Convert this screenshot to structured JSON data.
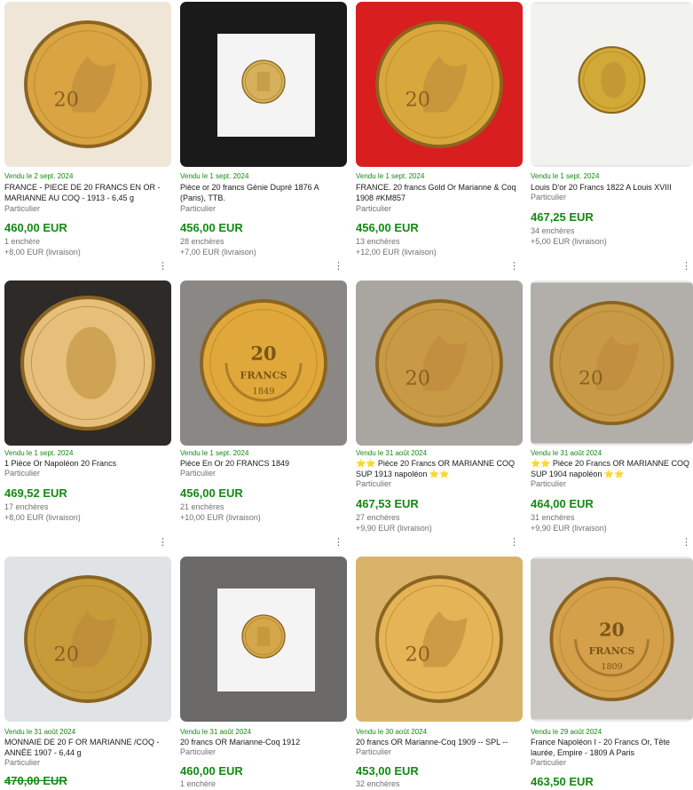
{
  "results": [
    {
      "sold": "Vendu le 2 sept. 2024",
      "title": "FRANCE - PIECE DE 20 FRANCS EN OR - MARIANNE AU COQ - 1913 - 6,45 g",
      "seller": "Particulier",
      "price": "460,00 EUR",
      "bids": "1 enchère",
      "shipping": "+8,00 EUR (livraison)",
      "coin": "rooster",
      "bg": "#efe6d8",
      "coinColor": "#d9a441"
    },
    {
      "sold": "Vendu le 1 sept. 2024",
      "title": "Pièce or 20 francs Génie Dupré 1876 A (Paris), TTB.",
      "seller": "Particulier",
      "price": "456,00 EUR",
      "bids": "28 enchères",
      "shipping": "+7,00 EUR (livraison)",
      "coin": "holder",
      "bg": "#1a1a1a",
      "coinColor": "#d4b15a"
    },
    {
      "sold": "Vendu le 1 sept. 2024",
      "title": "FRANCE. 20 francs Gold Or Marianne & Coq 1908 #KM857",
      "seller": "Particulier",
      "price": "456,00 EUR",
      "bids": "13 enchères",
      "shipping": "+12,00 EUR (livraison)",
      "coin": "rooster",
      "bg": "#d81e1e",
      "coinColor": "#d9a83c"
    },
    {
      "sold": "Vendu le 1 sept. 2024",
      "title": "Louis D'or 20 Francs 1822 A Louis XVIII",
      "seller": "Particulier",
      "price": "467,25 EUR",
      "bids": "34 enchères",
      "shipping": "+5,00 EUR (livraison)",
      "coin": "head",
      "bg": "#f2f2ef",
      "coinColor": "#d1a936"
    },
    {
      "sold": "Vendu le 1 sept. 2024",
      "title": "1 Pièce Or Napoléon 20 Francs",
      "seller": "Particulier",
      "price": "469,52 EUR",
      "bids": "17 enchères",
      "shipping": "+8,00 EUR (livraison)",
      "coin": "marianne",
      "bg": "#2e2a28",
      "coinColor": "#e6c07a"
    },
    {
      "sold": "Vendu le 1 sept. 2024",
      "title": "Pièce En Or 20 FRANCS 1849",
      "seller": "Particulier",
      "price": "456,00 EUR",
      "bids": "21 enchères",
      "shipping": "+10,00 EUR (livraison)",
      "coin": "wreath",
      "bg": "#8a8784",
      "coinColor": "#e0a83a"
    },
    {
      "sold": "Vendu le 31 août 2024",
      "title": "Pièce 20 Francs OR MARIANNE COQ SUP 1913 napoléon",
      "seller": "Particulier",
      "price": "467,53 EUR",
      "bids": "27 enchères",
      "shipping": "+9,90 EUR (livraison)",
      "coin": "rooster",
      "bg": "#a9a6a2",
      "coinColor": "#c99a45"
    },
    {
      "sold": "Vendu le 31 août 2024",
      "title": "Pièce 20 Francs OR MARIANNE COQ SUP 1904 napoléon",
      "seller": "Particulier",
      "price": "464,00 EUR",
      "bids": "31 enchères",
      "shipping": "+9,90 EUR (livraison)",
      "coin": "rooster",
      "bg": "#b2afab",
      "coinColor": "#c99a45"
    },
    {
      "sold": "Vendu le 31 août 2024",
      "title": "MONNAIE DE 20 F OR MARIANNE /COQ - ANNÉE 1907 - 6,44 g",
      "seller": "Particulier",
      "price": "470,00 EUR",
      "bids": "",
      "shipping": "",
      "coin": "rooster",
      "bg": "#dfe3e6",
      "coinColor": "#c79a3a"
    },
    {
      "sold": "Vendu le 31 août 2024",
      "title": "20 francs OR Marianne-Coq 1912",
      "seller": "Particulier",
      "price": "460,00 EUR",
      "bids": "1 enchère",
      "shipping": "",
      "coin": "holder",
      "bg": "#6c6a68",
      "coinColor": "#d4a74a"
    },
    {
      "sold": "Vendu le 30 août 2024",
      "title": "20 francs OR Marianne-Coq 1909 -- SPL --",
      "seller": "Particulier",
      "price": "453,00 EUR",
      "bids": "32 enchères",
      "shipping": "",
      "coin": "rooster",
      "bg": "#d9b36a",
      "coinColor": "#e4b456"
    },
    {
      "sold": "Vendu le 29 août 2024",
      "title": "France Napoléon I - 20 Francs Or, Tête laurée, Empire - 1809 A Paris",
      "seller": "Particulier",
      "price": "463,50 EUR",
      "bids": "",
      "shipping": "",
      "coin": "wreath",
      "bg": "#cbc7c2",
      "coinColor": "#d5a04a"
    }
  ],
  "labels": {
    "coin_20": "20",
    "coin_francs": "FRANCS",
    "coin_1849": "1849",
    "coin_1809": "1809"
  },
  "star": "⭐"
}
